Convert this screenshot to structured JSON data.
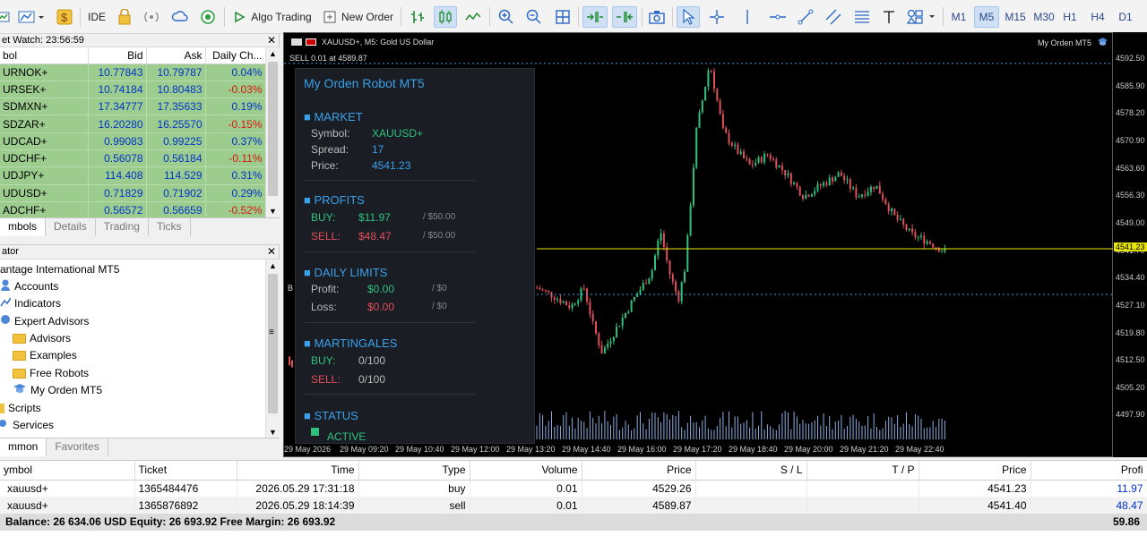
{
  "toolbar": {
    "ide_label": "IDE",
    "algo_trading_label": "Algo Trading",
    "new_order_label": "New Order",
    "timeframes": [
      "M1",
      "M5",
      "M15",
      "M30",
      "H1",
      "H4",
      "D1"
    ],
    "active_timeframe": "M5"
  },
  "market_watch": {
    "title": "et Watch: 23:56:59",
    "columns": [
      "bol",
      "Bid",
      "Ask",
      "Daily Ch..."
    ],
    "rows": [
      [
        "URNOK+",
        "10.77843",
        "10.79787",
        "0.04%"
      ],
      [
        "URSEK+",
        "10.74184",
        "10.80483",
        "-0.03%"
      ],
      [
        "SDMXN+",
        "17.34777",
        "17.35633",
        "0.19%"
      ],
      [
        "SDZAR+",
        "16.20280",
        "16.25570",
        "-0.15%"
      ],
      [
        "UDCAD+",
        "0.99083",
        "0.99225",
        "0.37%"
      ],
      [
        "UDCHF+",
        "0.56078",
        "0.56184",
        "-0.11%"
      ],
      [
        "UDJPY+",
        "114.408",
        "114.529",
        "0.31%"
      ],
      [
        "UDUSD+",
        "0.71829",
        "0.71902",
        "0.29%"
      ],
      [
        "ADCHF+",
        "0.56572",
        "0.56659",
        "-0.52%"
      ]
    ],
    "tabs": [
      "mbols",
      "Details",
      "Trading",
      "Ticks"
    ]
  },
  "navigator": {
    "title": "ator",
    "items": [
      "antage International MT5",
      "Accounts",
      "Indicators",
      "Expert Advisors",
      "Advisors",
      "Examples",
      "Free Robots",
      "My Orden MT5",
      "Scripts",
      "Services"
    ],
    "tabs": [
      "mmon",
      "Favorites"
    ]
  },
  "chart": {
    "symbol_label": "XAUUSD+, M5:  Gold US Dollar",
    "robot_label": "My Orden MT5",
    "sell_line_label": "SELL 0.01 at 4589.87",
    "current_price": "4541.23",
    "price_ticks": [
      "4592.50",
      "4585.90",
      "4578.20",
      "4570.90",
      "4563.60",
      "4556.30",
      "4549.00",
      "4541.70",
      "4534.40",
      "4527.10",
      "4519.80",
      "4512.50",
      "4505.20",
      "4497.90"
    ],
    "time_ticks": [
      "29 May 2026",
      "29 May 09:20",
      "29 May 10:40",
      "29 May 12:00",
      "29 May 13:20",
      "29 May 14:40",
      "29 May 16:00",
      "29 May 17:20",
      "29 May 18:40",
      "29 May 20:00",
      "29 May 21:20",
      "29 May 22:40"
    ],
    "b_label": "B"
  },
  "panel": {
    "title": "My Orden Robot MT5",
    "market_header": "■ MARKET",
    "symbol_label": "Symbol:",
    "symbol_value": "XAUUSD+",
    "spread_label": "Spread:",
    "spread_value": "17",
    "price_label": "Price:",
    "price_value": "4541.23",
    "profits_header": "■ PROFITS",
    "buy_label": "BUY:",
    "buy_value": "$11.97",
    "buy_target": "/ $50.00",
    "sell_label": "SELL:",
    "sell_value": "$48.47",
    "sell_target": "/ $50.00",
    "limits_header": "■ DAILY LIMITS",
    "profit_label": "Profit:",
    "profit_value": "$0.00",
    "profit_target": "/ $0",
    "loss_label": "Loss:",
    "loss_value": "$0.00",
    "loss_target": "/ $0",
    "mart_header": "■ MARTINGALES",
    "mart_buy_label": "BUY:",
    "mart_buy_value": "0/100",
    "mart_sell_label": "SELL:",
    "mart_sell_value": "0/100",
    "status_header": "■ STATUS",
    "status_value": "ACTIVE"
  },
  "trade": {
    "columns": [
      "ymbol",
      "Ticket",
      "Time",
      "Type",
      "Volume",
      "Price",
      "S / L",
      "T / P",
      "Price",
      "Profi"
    ],
    "rows": [
      [
        "xauusd+",
        "1365484476",
        "2026.05.29 17:31:18",
        "buy",
        "0.01",
        "4529.26",
        "",
        "",
        "4541.23",
        "11.97"
      ],
      [
        "xauusd+",
        "1365876892",
        "2026.05.29 18:14:39",
        "sell",
        "0.01",
        "4589.87",
        "",
        "",
        "4541.40",
        "48.47"
      ]
    ],
    "balance_text": "Balance: 26 634.06 USD  Equity: 26 693.92  Free Margin: 26 693.92",
    "total_profit": "59.86"
  },
  "colors": {
    "up": "#2ec27e",
    "down": "#e0505a",
    "panel_accent": "#3aa0e8",
    "current_line": "#e8e800"
  }
}
